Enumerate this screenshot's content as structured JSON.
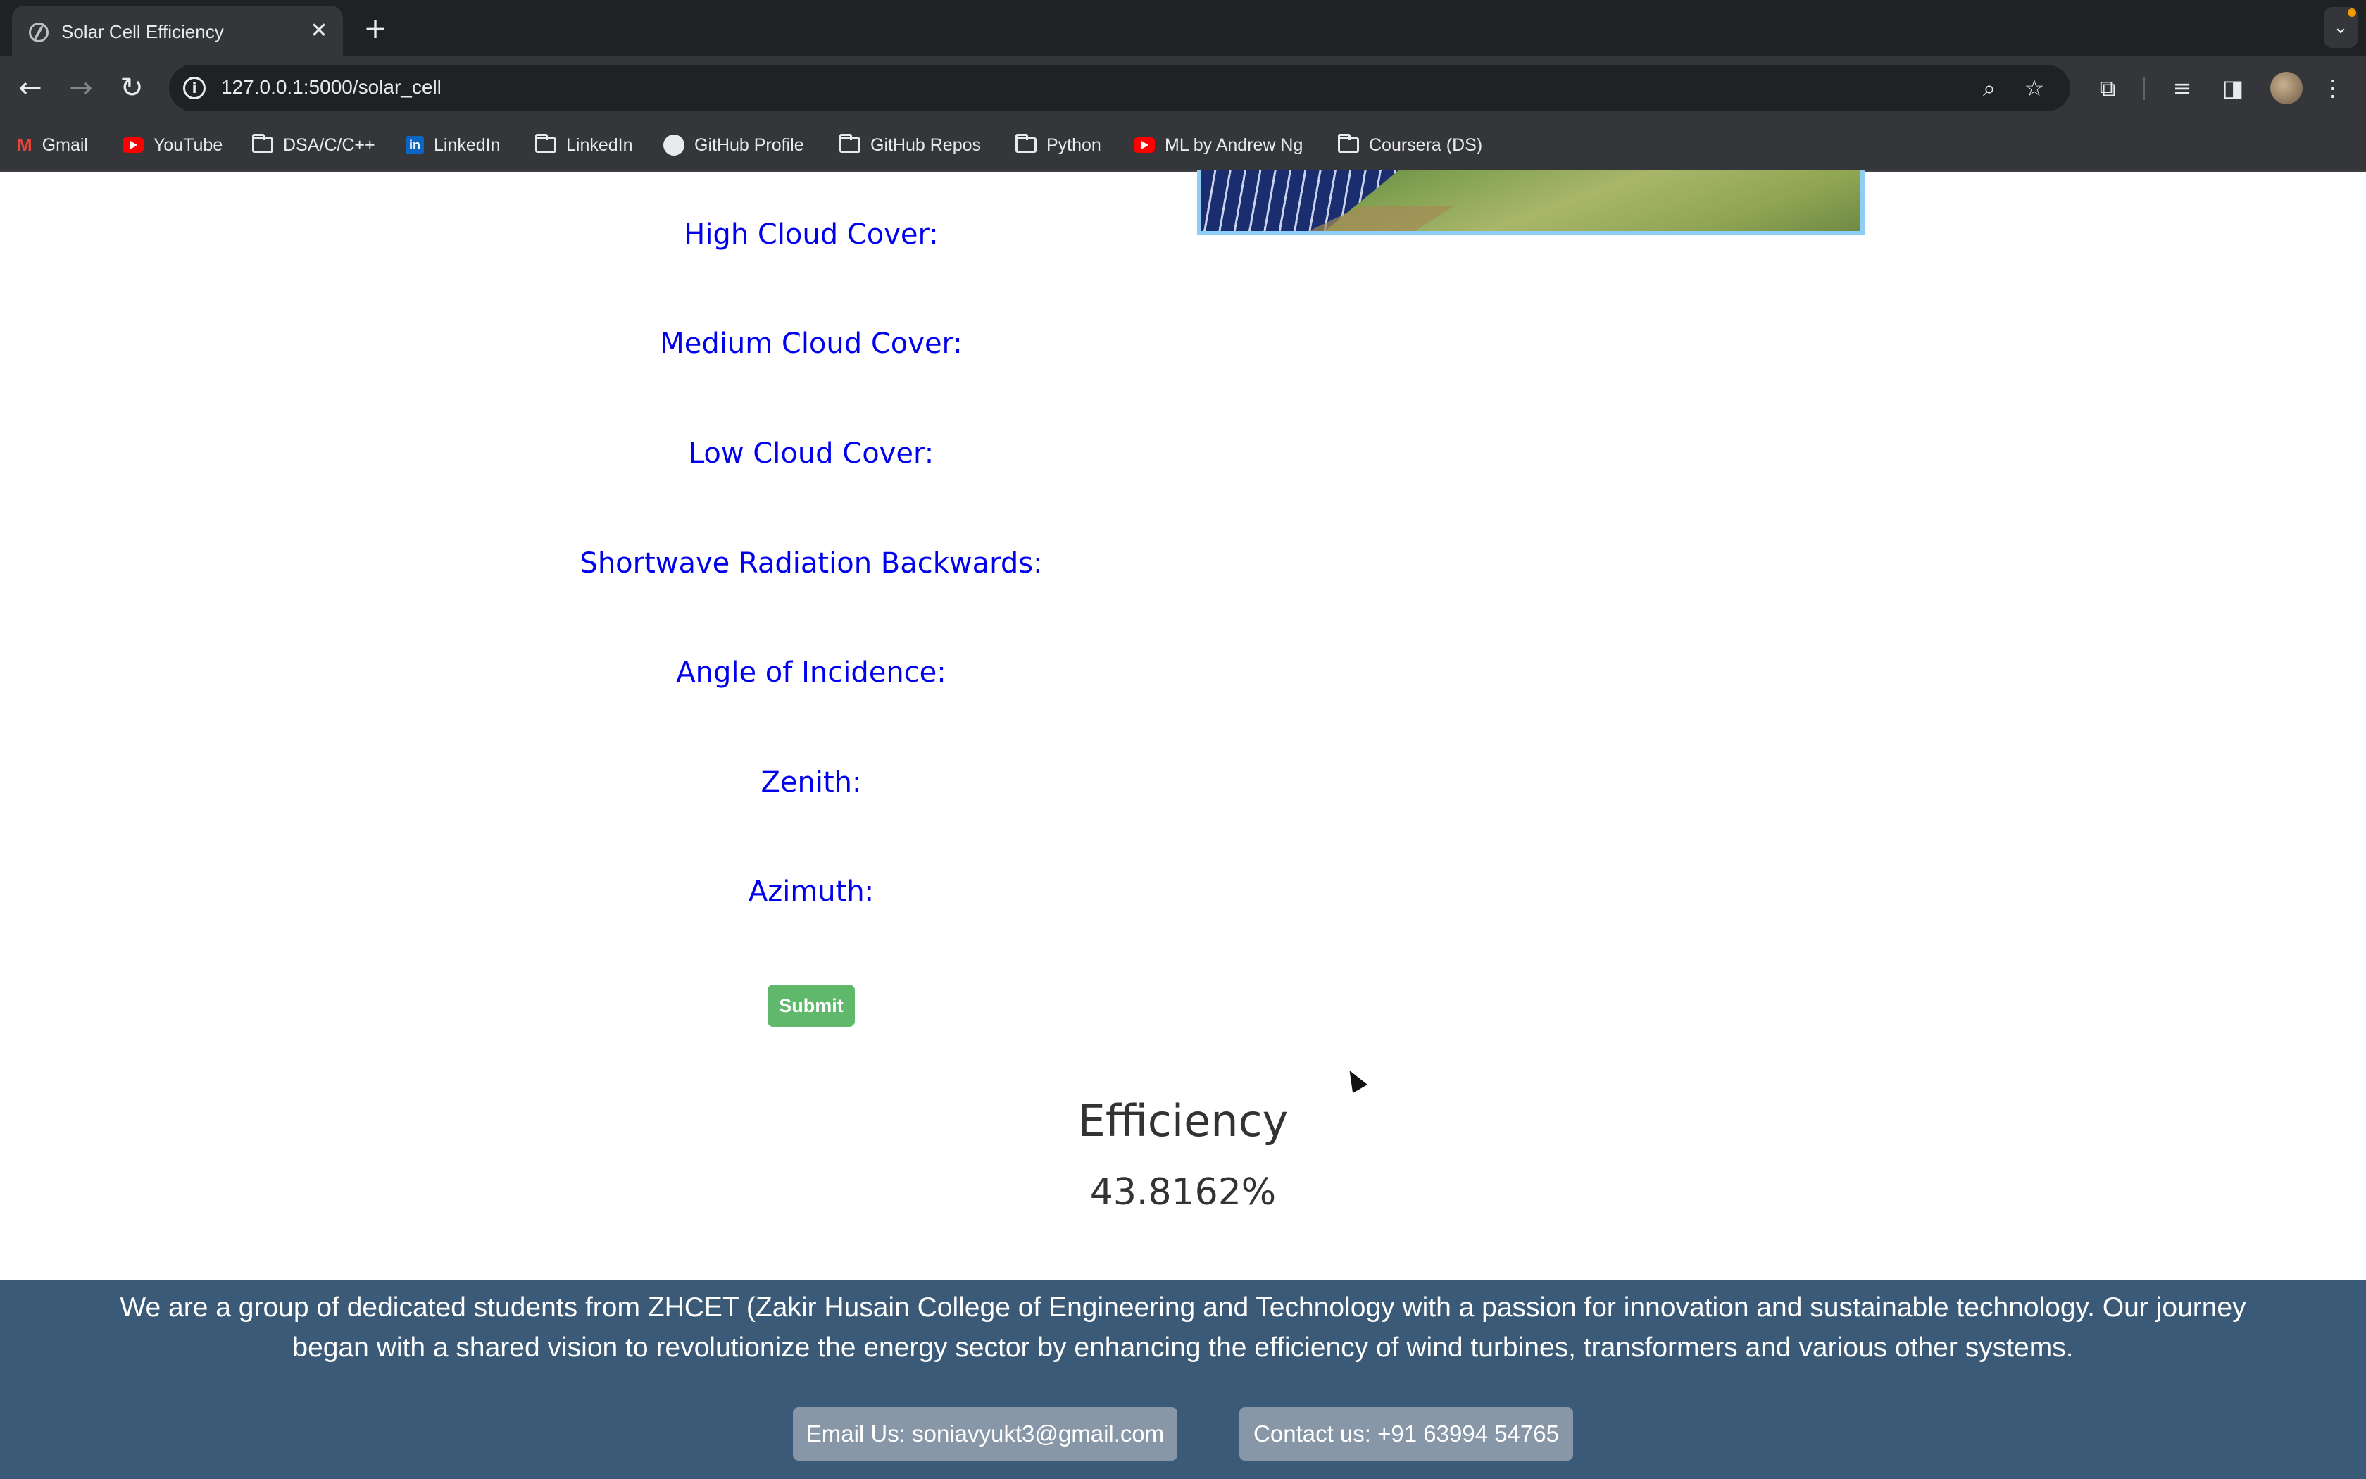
{
  "browser": {
    "tab_title": "Solar Cell Efficiency",
    "url": "127.0.0.1:5000/solar_cell",
    "bookmarks": [
      {
        "label": "Gmail",
        "icon": "gmail-icon"
      },
      {
        "label": "YouTube",
        "icon": "youtube-icon"
      },
      {
        "label": "DSA/C/C++",
        "icon": "folder-icon"
      },
      {
        "label": "LinkedIn",
        "icon": "linkedin-icon"
      },
      {
        "label": "LinkedIn",
        "icon": "folder-icon"
      },
      {
        "label": "GitHub Profile",
        "icon": "github-icon"
      },
      {
        "label": "GitHub Repos",
        "icon": "folder-icon"
      },
      {
        "label": "Python",
        "icon": "folder-icon"
      },
      {
        "label": "ML by Andrew Ng",
        "icon": "youtube-icon"
      },
      {
        "label": "Coursera (DS)",
        "icon": "folder-icon"
      }
    ]
  },
  "form": {
    "fields": [
      {
        "label": "High Cloud Cover:"
      },
      {
        "label": "Medium Cloud Cover:"
      },
      {
        "label": "Low Cloud Cover:"
      },
      {
        "label": "Shortwave Radiation Backwards:"
      },
      {
        "label": "Angle of Incidence:"
      },
      {
        "label": "Zenith:"
      },
      {
        "label": "Azimuth:"
      }
    ],
    "submit_label": "Submit"
  },
  "result": {
    "heading": "Efficiency",
    "value": "43.8162%"
  },
  "footer": {
    "about": "We are a group of dedicated students from ZHCET (Zakir Husain College of Engineering and Technology with a passion for innovation and sustainable technology. Our journey began with a shared vision to revolutionize the energy sector by enhancing the efficiency of wind turbines, transformers and various other systems.",
    "email_label": "Email Us: soniavyukt3@gmail.com",
    "contact_label": "Contact us: +91 63994 54765"
  },
  "colors": {
    "label_blue": "#0000ee",
    "submit_green": "#5fb86b",
    "footer_bg": "#3b5a77",
    "footer_button": "#8797a8"
  }
}
